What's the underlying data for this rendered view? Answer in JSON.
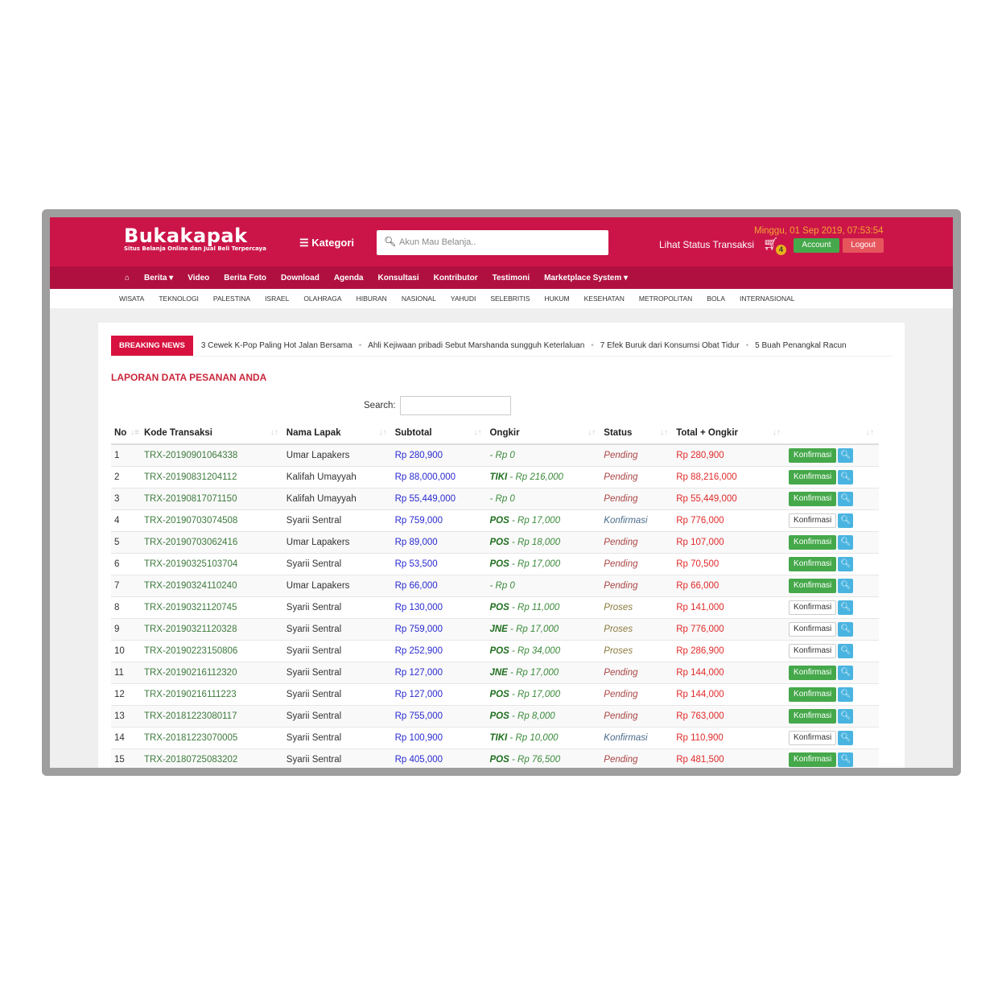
{
  "header": {
    "logo": "Bukakapak",
    "tagline": "Situs Belanja Online dan Jual Beli Terpercaya",
    "kategori": "Kategori",
    "search_placeholder": "Akun Mau Belanja..",
    "lihat_status": "Lihat Status Transaksi",
    "cart_count": "4",
    "datetime": "Minggu, 01 Sep 2019, 07:53:54",
    "account": "Account",
    "logout": "Logout"
  },
  "nav": [
    "Berita ▾",
    "Video",
    "Berita Foto",
    "Download",
    "Agenda",
    "Konsultasi",
    "Kontributor",
    "Testimoni",
    "Marketplace System ▾"
  ],
  "categories": [
    "WISATA",
    "TEKNOLOGI",
    "PALESTINA",
    "ISRAEL",
    "OLAHRAGA",
    "HIBURAN",
    "NASIONAL",
    "YAHUDI",
    "SELEBRITIS",
    "HUKUM",
    "KESEHATAN",
    "METROPOLITAN",
    "BOLA",
    "INTERNASIONAL"
  ],
  "breaking": {
    "label": "BREAKING NEWS",
    "items": [
      "3 Cewek K-Pop Paling Hot Jalan Bersama",
      "Ahli Kejiwaan pribadi Sebut Marshanda sungguh Keterlaluan",
      "7 Efek Buruk dari Konsumsi Obat Tidur",
      "5 Buah Penangkal Racun"
    ]
  },
  "page_title": "LAPORAN DATA PESANAN ANDA",
  "search_label": "Search:",
  "table": {
    "headers": [
      "No",
      "Kode Transaksi",
      "Nama Lapak",
      "Subtotal",
      "Ongkir",
      "Status",
      "Total + Ongkir",
      ""
    ],
    "action_label": "Konfirmasi",
    "rows": [
      [
        "1",
        "TRX-20190901064338",
        "Umar Lapakers",
        "Rp 280,900",
        "",
        "Rp 0",
        "Pending",
        "Rp 280,900"
      ],
      [
        "2",
        "TRX-20190831204112",
        "Kalifah Umayyah",
        "Rp 88,000,000",
        "TIKI",
        "Rp 216,000",
        "Pending",
        "Rp 88,216,000"
      ],
      [
        "3",
        "TRX-20190817071150",
        "Kalifah Umayyah",
        "Rp 55,449,000",
        "",
        "Rp 0",
        "Pending",
        "Rp 55,449,000"
      ],
      [
        "4",
        "TRX-20190703074508",
        "Syarii Sentral",
        "Rp 759,000",
        "POS",
        "Rp 17,000",
        "Konfirmasi",
        "Rp 776,000"
      ],
      [
        "5",
        "TRX-20190703062416",
        "Umar Lapakers",
        "Rp 89,000",
        "POS",
        "Rp 18,000",
        "Pending",
        "Rp 107,000"
      ],
      [
        "6",
        "TRX-20190325103704",
        "Syarii Sentral",
        "Rp 53,500",
        "POS",
        "Rp 17,000",
        "Pending",
        "Rp 70,500"
      ],
      [
        "7",
        "TRX-20190324110240",
        "Umar Lapakers",
        "Rp 66,000",
        "",
        "Rp 0",
        "Pending",
        "Rp 66,000"
      ],
      [
        "8",
        "TRX-20190321120745",
        "Syarii Sentral",
        "Rp 130,000",
        "POS",
        "Rp 11,000",
        "Proses",
        "Rp 141,000"
      ],
      [
        "9",
        "TRX-20190321120328",
        "Syarii Sentral",
        "Rp 759,000",
        "JNE",
        "Rp 17,000",
        "Proses",
        "Rp 776,000"
      ],
      [
        "10",
        "TRX-20190223150806",
        "Syarii Sentral",
        "Rp 252,900",
        "POS",
        "Rp 34,000",
        "Proses",
        "Rp 286,900"
      ],
      [
        "11",
        "TRX-20190216112320",
        "Syarii Sentral",
        "Rp 127,000",
        "JNE",
        "Rp 17,000",
        "Pending",
        "Rp 144,000"
      ],
      [
        "12",
        "TRX-20190216111223",
        "Syarii Sentral",
        "Rp 127,000",
        "POS",
        "Rp 17,000",
        "Pending",
        "Rp 144,000"
      ],
      [
        "13",
        "TRX-20181223080117",
        "Syarii Sentral",
        "Rp 755,000",
        "POS",
        "Rp 8,000",
        "Pending",
        "Rp 763,000"
      ],
      [
        "14",
        "TRX-20181223070005",
        "Syarii Sentral",
        "Rp 100,900",
        "TIKI",
        "Rp 10,000",
        "Konfirmasi",
        "Rp 110,900"
      ],
      [
        "15",
        "TRX-20180725083202",
        "Syarii Sentral",
        "Rp 405,000",
        "POS",
        "Rp 76,500",
        "Pending",
        "Rp 481,500"
      ]
    ]
  },
  "colors": {
    "brand": "#cb1549",
    "nav": "#b01040",
    "confirm": "#45a84a",
    "total": "#e02a2a"
  }
}
